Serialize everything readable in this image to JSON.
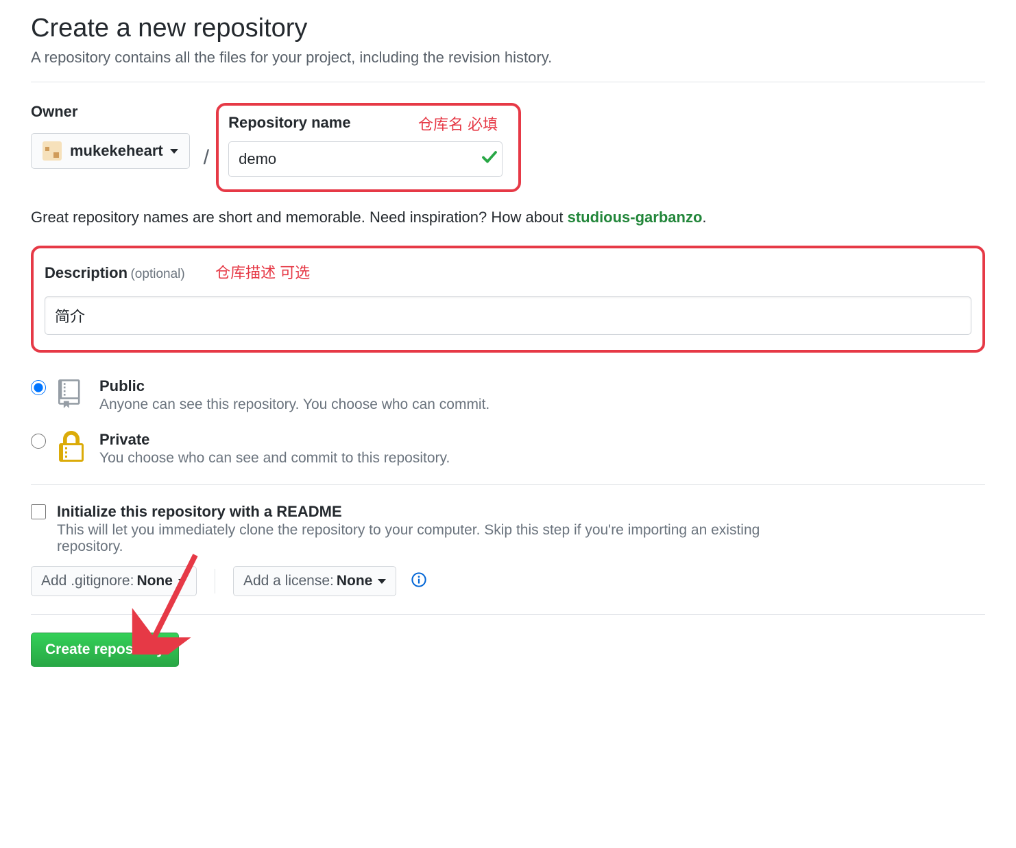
{
  "header": {
    "title": "Create a new repository",
    "subtitle": "A repository contains all the files for your project, including the revision history."
  },
  "owner": {
    "label": "Owner",
    "username": "mukekeheart"
  },
  "repo_name": {
    "label": "Repository name",
    "value": "demo"
  },
  "name_hint": {
    "prefix": "Great repository names are short and memorable. Need inspiration? How about ",
    "suggestion": "studious-garbanzo",
    "suffix": "."
  },
  "description": {
    "label": "Description",
    "optional": "(optional)",
    "value": "简介"
  },
  "visibility": {
    "public": {
      "title": "Public",
      "desc": "Anyone can see this repository. You choose who can commit."
    },
    "private": {
      "title": "Private",
      "desc": "You choose who can see and commit to this repository."
    }
  },
  "readme": {
    "title": "Initialize this repository with a README",
    "desc": "This will let you immediately clone the repository to your computer. Skip this step if you're importing an existing repository."
  },
  "dropdowns": {
    "gitignore_label": "Add .gitignore:",
    "gitignore_value": "None",
    "license_label": "Add a license:",
    "license_value": "None"
  },
  "submit": {
    "label": "Create repository"
  },
  "annotations": {
    "name": "仓库名  必填",
    "desc": "仓库描述 可选"
  }
}
